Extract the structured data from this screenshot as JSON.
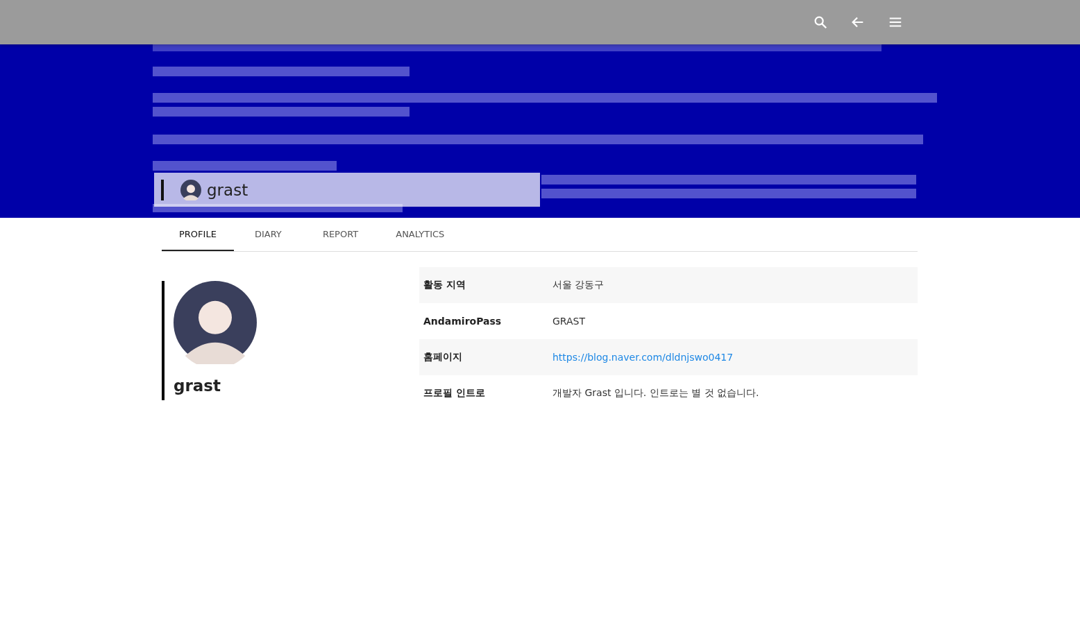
{
  "header_overlay": {
    "name": "grast"
  },
  "tabs": [
    {
      "label": "PROFILE",
      "selected": true
    },
    {
      "label": "DIARY",
      "selected": false
    },
    {
      "label": "REPORT",
      "selected": false
    },
    {
      "label": "ANALYTICS",
      "selected": false
    }
  ],
  "profile": {
    "name": "grast"
  },
  "details": [
    {
      "label": "활동 지역",
      "value": "서울 강동구",
      "kind": "text"
    },
    {
      "label": "AndamiroPass",
      "value": "GRAST",
      "kind": "text"
    },
    {
      "label": "홈페이지",
      "value": "https://blog.naver.com/dldnjswo0417",
      "kind": "link"
    },
    {
      "label": "프로필 인트로",
      "value": "개발자 Grast 입니다. 인트로는 별 것 없습니다.",
      "kind": "text"
    }
  ]
}
